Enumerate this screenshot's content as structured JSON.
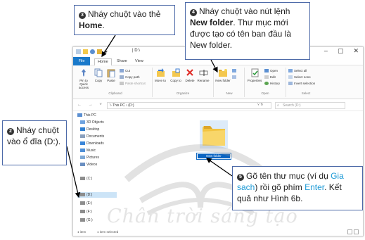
{
  "window": {
    "title_bar": "|  D:\\",
    "tabs": [
      "File",
      "Home",
      "Share",
      "View"
    ],
    "ribbon": {
      "pin_label": "Pin to Quick access",
      "copy_label": "Copy",
      "paste_label": "Paste",
      "cut_label": "Cut",
      "copy_path_label": "Copy path",
      "paste_shortcut_label": "Paste shortcut",
      "move_to_label": "Move to",
      "copy_to_label": "Copy to",
      "delete_label": "Delete",
      "rename_label": "Rename",
      "new_folder_label": "New folder",
      "new_item_label": "New item",
      "properties_label": "Properties",
      "open_label": "Open",
      "edit_label": "Edit",
      "history_label": "History",
      "select_all_label": "Select all",
      "select_none_label": "Select none",
      "invert_selection_label": "Invert selection",
      "group_clipboard": "Clipboard",
      "group_organize": "Organize",
      "group_new": "New",
      "group_open": "Open",
      "group_select": "Select"
    },
    "address": "›  This PC  ›  (D:)",
    "search_placeholder": "Search (D:)",
    "nav_items": [
      "This PC",
      "3D Objects",
      "Desktop",
      "Documents",
      "Downloads",
      "Music",
      "Pictures",
      "Videos",
      "(C:)",
      "(D:)",
      "(E:)",
      "(F:)",
      "(G:)"
    ],
    "new_folder_name": "New folder",
    "status_items": "1 item",
    "status_selected": "1 item selected"
  },
  "callouts": {
    "c3": {
      "num": "3",
      "before": "Nháy chuột vào thẻ ",
      "bold": "Home",
      "after": "."
    },
    "c4": {
      "num": "4",
      "before": "Nháy chuột vào nút lệnh ",
      "bold": "New folder",
      "after": ". Thư mục mới được tạo có tên ban đầu là New folder."
    },
    "c2": {
      "num": "2",
      "text": "Nháy chuột vào ổ đĩa (D:)."
    },
    "c5": {
      "num": "5",
      "p1": "Gõ tên thư mục (ví dụ ",
      "example": "Gia sach",
      "p2": ") rồi gõ phím ",
      "key": "Enter",
      "p3": ". Kết quả như Hình 6b."
    }
  },
  "watermark": "Chân trời sáng tạo",
  "colors": {
    "accent": "#1979ca",
    "callout_border": "#4d6aa8",
    "highlight_text": "#1d9ad6",
    "selection": "#0a64c2"
  }
}
